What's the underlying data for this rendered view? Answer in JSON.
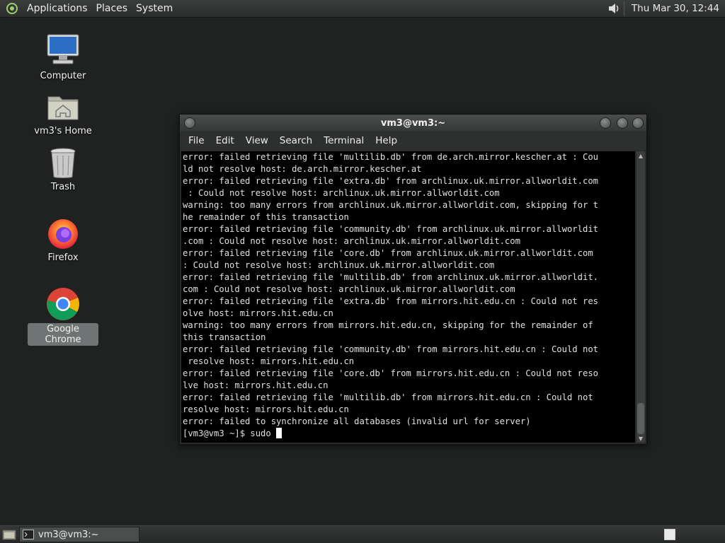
{
  "top_panel": {
    "menus": [
      "Applications",
      "Places",
      "System"
    ],
    "clock": "Thu Mar 30, 12:44"
  },
  "desktop": {
    "icons": [
      {
        "label": "Computer"
      },
      {
        "label": "vm3's Home"
      },
      {
        "label": "Trash"
      },
      {
        "label": "Firefox"
      },
      {
        "label": "Google Chrome"
      }
    ]
  },
  "window": {
    "title": "vm3@vm3:~",
    "menus": [
      "File",
      "Edit",
      "View",
      "Search",
      "Terminal",
      "Help"
    ],
    "terminal_lines": [
      "error: failed retrieving file 'multilib.db' from de.arch.mirror.kescher.at : Cou",
      "ld not resolve host: de.arch.mirror.kescher.at",
      "error: failed retrieving file 'extra.db' from archlinux.uk.mirror.allworldit.com",
      " : Could not resolve host: archlinux.uk.mirror.allworldit.com",
      "warning: too many errors from archlinux.uk.mirror.allworldit.com, skipping for t",
      "he remainder of this transaction",
      "error: failed retrieving file 'community.db' from archlinux.uk.mirror.allworldit",
      ".com : Could not resolve host: archlinux.uk.mirror.allworldit.com",
      "error: failed retrieving file 'core.db' from archlinux.uk.mirror.allworldit.com",
      ": Could not resolve host: archlinux.uk.mirror.allworldit.com",
      "error: failed retrieving file 'multilib.db' from archlinux.uk.mirror.allworldit.",
      "com : Could not resolve host: archlinux.uk.mirror.allworldit.com",
      "error: failed retrieving file 'extra.db' from mirrors.hit.edu.cn : Could not res",
      "olve host: mirrors.hit.edu.cn",
      "warning: too many errors from mirrors.hit.edu.cn, skipping for the remainder of",
      "this transaction",
      "error: failed retrieving file 'community.db' from mirrors.hit.edu.cn : Could not",
      " resolve host: mirrors.hit.edu.cn",
      "error: failed retrieving file 'core.db' from mirrors.hit.edu.cn : Could not reso",
      "lve host: mirrors.hit.edu.cn",
      "error: failed retrieving file 'multilib.db' from mirrors.hit.edu.cn : Could not",
      "resolve host: mirrors.hit.edu.cn",
      "error: failed to synchronize all databases (invalid url for server)"
    ],
    "prompt": "[vm3@vm3 ~]$ sudo "
  },
  "bottom_panel": {
    "task_label": "vm3@vm3:~"
  }
}
